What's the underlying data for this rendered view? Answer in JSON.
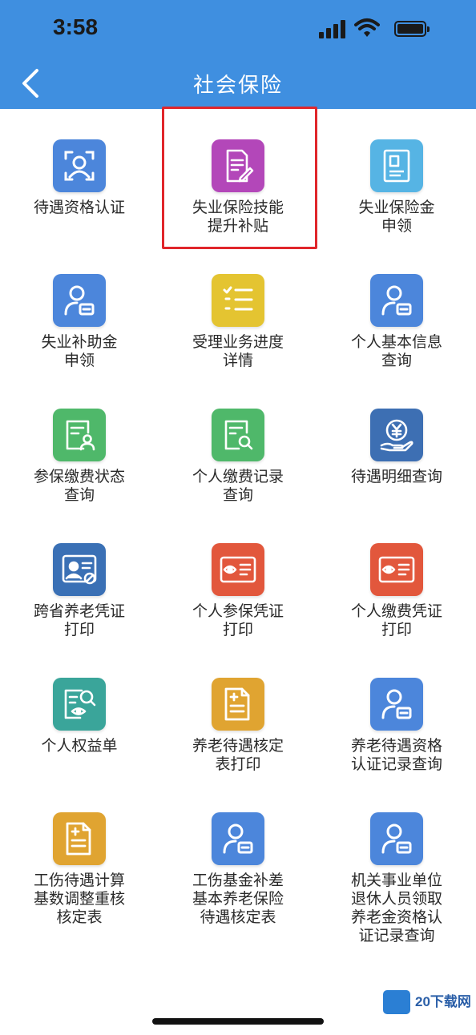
{
  "status_bar": {
    "time": "3:58"
  },
  "header": {
    "title": "社会保险"
  },
  "items": [
    {
      "label": "待遇资格认证",
      "icon": "face-scan-icon",
      "color": "#4c86db"
    },
    {
      "label": "失业保险技能提升补贴",
      "icon": "document-edit-icon",
      "color": "#b347b9"
    },
    {
      "label": "失业保险金申领",
      "icon": "id-document-icon",
      "color": "#56b4e4"
    },
    {
      "label": "失业补助金申领",
      "icon": "person-card-icon",
      "color": "#4c86db"
    },
    {
      "label": "受理业务进度详情",
      "icon": "checklist-icon",
      "color": "#e4c431"
    },
    {
      "label": "个人基本信息查询",
      "icon": "person-card-icon",
      "color": "#4c86db"
    },
    {
      "label": "参保缴费状态查询",
      "icon": "doc-person-icon",
      "color": "#4fb86a"
    },
    {
      "label": "个人缴费记录查询",
      "icon": "doc-search-icon",
      "color": "#4fb86a"
    },
    {
      "label": "待遇明细查询",
      "icon": "yuan-hand-icon",
      "color": "#3d6fb3"
    },
    {
      "label": "跨省养老凭证打印",
      "icon": "id-badge-icon",
      "color": "#3a70b5"
    },
    {
      "label": "个人参保凭证打印",
      "icon": "eye-card-icon",
      "color": "#e2573c"
    },
    {
      "label": "个人缴费凭证打印",
      "icon": "eye-card-icon",
      "color": "#e2573c"
    },
    {
      "label": "个人权益单",
      "icon": "doc-search-eye-icon",
      "color": "#3aa59a"
    },
    {
      "label": "养老待遇核定表打印",
      "icon": "doc-plus-icon",
      "color": "#e0a431"
    },
    {
      "label": "养老待遇资格认证记录查询",
      "icon": "person-card-icon",
      "color": "#4c86db"
    },
    {
      "label": "工伤待遇计算基数调整重核核定表",
      "icon": "doc-plus-icon",
      "color": "#e0a431"
    },
    {
      "label": "工伤基金补差基本养老保险待遇核定表",
      "icon": "person-card-icon",
      "color": "#4c86db"
    },
    {
      "label": "机关事业单位退休人员领取养老金资格认证记录查询",
      "icon": "person-card-icon",
      "color": "#4c86db"
    }
  ],
  "watermark": {
    "text": "20下载网"
  }
}
